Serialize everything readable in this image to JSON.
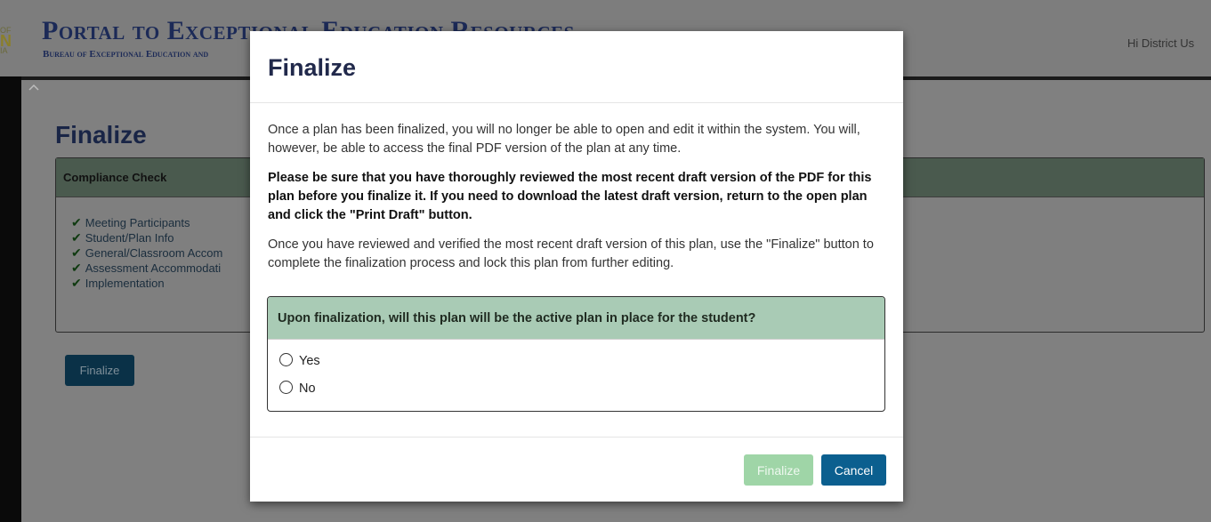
{
  "app": {
    "edge_logo": [
      "OF",
      "N",
      "IA"
    ],
    "brand_title": "Portal to Exceptional Education Resources",
    "brand_subtitle": "Bureau of Exceptional Education and",
    "greeting": "Hi District Us"
  },
  "background_page": {
    "title": "Finalize",
    "panel_title": "Compliance Check",
    "checks": [
      "Meeting Participants",
      "Student/Plan Info",
      "General/Classroom Accom",
      "Assessment Accommodati",
      "Implementation"
    ],
    "finalize_label": "Finalize"
  },
  "modal": {
    "title": "Finalize",
    "paragraph_1": "Once a plan has been finalized, you will no longer be able to open and edit it within the system. You will, however, be able to access the final PDF version of the plan at any time.",
    "paragraph_2": "Please be sure that you have thoroughly reviewed the most recent draft version of the PDF for this plan before you finalize it. If you need to download the latest draft version, return to the open plan and click the \"Print Draft\" button.",
    "paragraph_3": "Once you have reviewed and verified the most recent draft version of this plan, use the \"Finalize\" button to complete the finalization process and lock this plan from further editing.",
    "question": "Upon finalization, will this plan will be the active plan in place for the student?",
    "options": [
      "Yes",
      "No"
    ],
    "finalize_label": "Finalize",
    "cancel_label": "Cancel"
  },
  "colors": {
    "overlay": "#7f7f7f",
    "question_header": "#a9cbb5",
    "finalize_disabled": "#9fd5a7",
    "cancel": "#0b5f8f"
  }
}
